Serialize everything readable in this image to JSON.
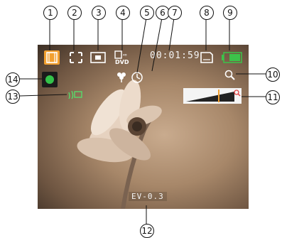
{
  "camera_screen": {
    "recording_time": "00:01:59",
    "exposure_value": "EV-0.3",
    "battery_level": 1.0,
    "zoom_level": 0.6,
    "accent_color": "#f2a030",
    "battery_color": "#3cc24a",
    "icons": [
      "movie-mode-icon",
      "focus-frame-icon",
      "video-size-icon",
      "dvd-quality-icon",
      "macro-icon",
      "self-timer-icon",
      "memory-card-icon",
      "battery-icon",
      "zoom-icon",
      "stabilizer-icon",
      "record-status-icon"
    ]
  },
  "callouts": [
    "1",
    "2",
    "3",
    "4",
    "5",
    "6",
    "7",
    "8",
    "9",
    "10",
    "11",
    "12",
    "13",
    "14"
  ]
}
